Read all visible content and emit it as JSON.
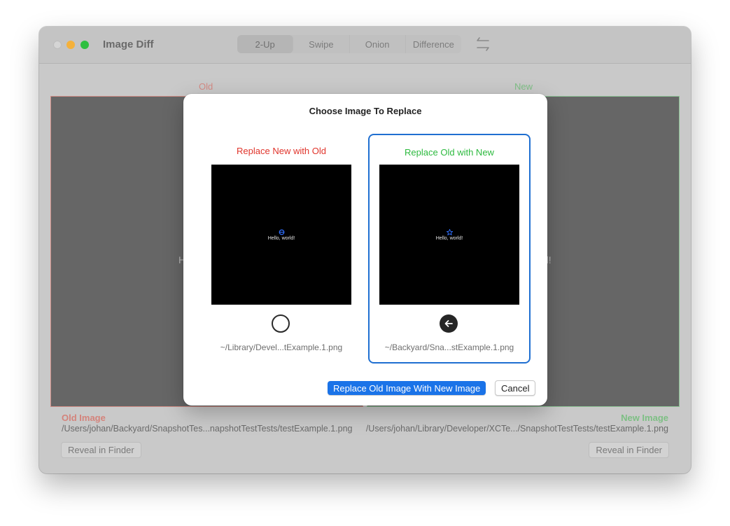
{
  "window": {
    "title": "Image Diff"
  },
  "toolbar": {
    "modes": [
      "2-Up",
      "Swipe",
      "Onion",
      "Difference"
    ],
    "active_mode": "2-Up",
    "swap_icon": "swap-arrows-icon"
  },
  "panes": {
    "old_label": "Old",
    "new_label": "New",
    "old_text_fragment": "H",
    "new_text_fragment": "d!"
  },
  "footer": {
    "old_title": "Old Image",
    "old_path": "/Users/johan/Backyard/SnapshotTes...napshotTestTests/testExample.1.png",
    "new_title": "New Image",
    "new_path": "/Users/johan/Library/Developer/XCTe.../SnapshotTestTests/testExample.1.png",
    "reveal_label": "Reveal in Finder"
  },
  "dialog": {
    "title": "Choose Image To Replace",
    "left_option": {
      "label": "Replace New with Old",
      "preview_text": "Hello, world!",
      "path": "~/Library/Devel...tExample.1.png",
      "selected": false
    },
    "right_option": {
      "label": "Replace Old with New",
      "preview_text": "Hello, world!",
      "path": "~/Backyard/Sna...stExample.1.png",
      "selected": true
    },
    "primary_button": "Replace Old Image With New Image",
    "cancel_button": "Cancel"
  },
  "colors": {
    "old": "#e0342b",
    "new": "#2dba3f",
    "accent": "#1a73e8"
  }
}
